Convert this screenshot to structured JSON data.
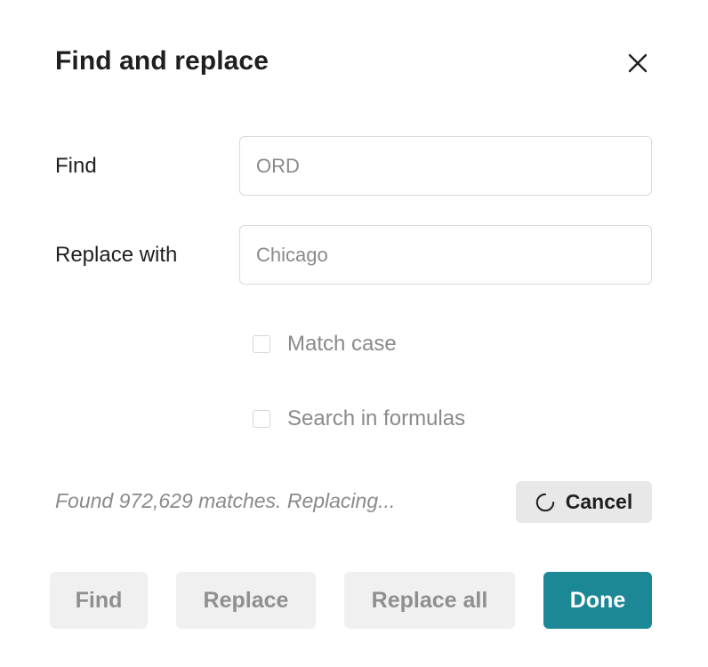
{
  "dialog": {
    "title": "Find and replace",
    "close_icon": "close-icon"
  },
  "fields": {
    "find": {
      "label": "Find",
      "placeholder": "ORD",
      "value": ""
    },
    "replace": {
      "label": "Replace with",
      "placeholder": "Chicago",
      "value": ""
    }
  },
  "options": {
    "match_case": {
      "label": "Match case",
      "checked": false
    },
    "search_formulas": {
      "label": "Search in formulas",
      "checked": false
    }
  },
  "status": {
    "message": "Found 972,629 matches. Replacing...",
    "cancel_label": "Cancel",
    "spinner_icon": "spinner-icon"
  },
  "footer": {
    "find_label": "Find",
    "replace_label": "Replace",
    "replace_all_label": "Replace all",
    "done_label": "Done"
  },
  "colors": {
    "primary": "#1c8896",
    "disabled_bg": "#f0f0f0",
    "cancel_bg": "#e8e8e8"
  }
}
